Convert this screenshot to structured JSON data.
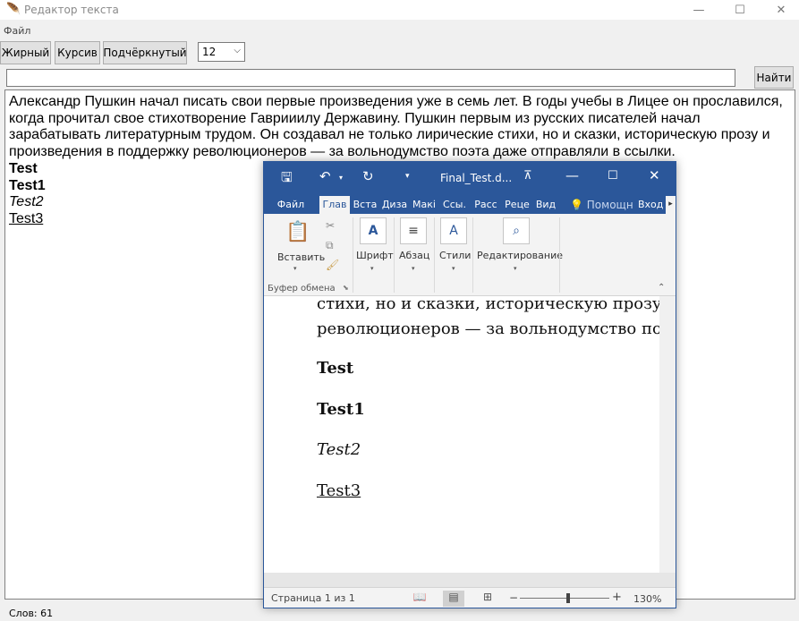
{
  "window": {
    "title": "Редактор текста",
    "minimize": "—",
    "maximize": "☐",
    "close": "✕"
  },
  "menu": {
    "file": "Файл"
  },
  "toolbar": {
    "bold": "Жирный",
    "italic": "Курсив",
    "underline": "Подчёркнутый",
    "font_size": "12"
  },
  "search": {
    "value": "",
    "button": "Найти"
  },
  "editor": {
    "paragraph": "Александр Пушкин начал писать свои первые произведения уже в семь лет. В годы учебы в Лицее он прославился, когда прочитал свое стихотворение Гаврииилу Державину. Пушкин первым из русских писателей начал зарабатывать литературным трудом. Он создавал не только лирические стихи, но и сказки, историческую прозу и произведения в поддержку революционеров — за вольнодумство поэта даже отправляли в ссылки.",
    "line1": "Test",
    "line2": "Test1",
    "line3": "Test2",
    "line4": "Test3"
  },
  "status": {
    "words": "Слов: 61"
  },
  "word": {
    "doc_title": "Final_Test.d...",
    "tabs": [
      "Файл",
      "Глав",
      "Вста",
      "Диза",
      "Макі",
      "Ссы.",
      "Расс",
      "Реце",
      "Вид"
    ],
    "help": "Помощн",
    "login": "Вход",
    "ribbon": {
      "paste": "Вставить",
      "clipboard": "Буфер обмена",
      "font": "Шрифт",
      "paragraph": "Абзац",
      "styles": "Стили",
      "editing": "Редактирование"
    },
    "doc_lines": {
      "l1": "стихи, но и сказки, историческую прозу и",
      "l2": "революционеров — за вольнодумство по",
      "l3": "Test",
      "l4": "Test1",
      "l5": "Test2",
      "l6": "Test3"
    },
    "status": {
      "page": "Страница 1 из 1",
      "zoom": "130%"
    }
  }
}
